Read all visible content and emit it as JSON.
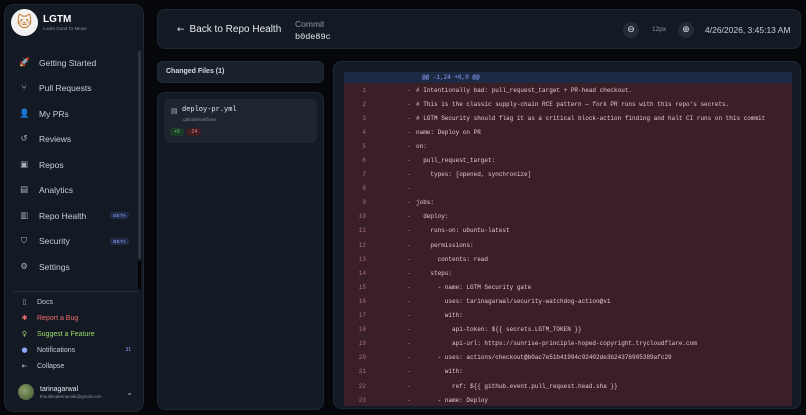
{
  "brand": {
    "name": "LGTM",
    "tagline": "Looks Good To Meow",
    "logo_glyph": "🐱"
  },
  "nav": [
    {
      "label": "Getting Started",
      "icon": "rocket-icon",
      "glyph": "🚀"
    },
    {
      "label": "Pull Requests",
      "icon": "pull-request-icon",
      "glyph": "⑂"
    },
    {
      "label": "My PRs",
      "icon": "user-icon",
      "glyph": "👤"
    },
    {
      "label": "Reviews",
      "icon": "history-icon",
      "glyph": "↺"
    },
    {
      "label": "Repos",
      "icon": "repo-icon",
      "glyph": "▣"
    },
    {
      "label": "Analytics",
      "icon": "bar-chart-icon",
      "glyph": "▤"
    },
    {
      "label": "Repo Health",
      "icon": "health-bars-icon",
      "glyph": "▥",
      "badge": "BETA"
    },
    {
      "label": "Security",
      "icon": "shield-icon",
      "glyph": "⛉",
      "badge": "BETA"
    },
    {
      "label": "Settings",
      "icon": "gear-icon",
      "glyph": "⚙"
    }
  ],
  "bottom_nav": {
    "docs": {
      "label": "Docs",
      "icon": "book-icon",
      "glyph": "▯"
    },
    "bug": {
      "label": "Report a Bug",
      "icon": "bug-icon",
      "glyph": "✱"
    },
    "suggest": {
      "label": "Suggest a Feature",
      "icon": "lightbulb-icon",
      "glyph": "♀"
    },
    "notifications": {
      "label": "Notifications",
      "icon": "notification-icon",
      "glyph": "●",
      "count": "31"
    },
    "collapse": {
      "label": "Collapse",
      "icon": "collapse-icon",
      "glyph": "⇤"
    }
  },
  "user": {
    "name": "tarinagarwal",
    "email": "theultimatemaniak@gmail.com"
  },
  "header": {
    "back_label": "Back to Repo Health",
    "commit_label": "Commit",
    "commit_hash": "b0de89c",
    "zoom_level": "12px",
    "timestamp": "4/26/2026, 3:45:13 AM"
  },
  "files": {
    "heading": "Changed Files (1)",
    "items": [
      {
        "name": "deploy-pr.yml",
        "path": ".github/workflows",
        "additions": "+0",
        "deletions": "-24"
      }
    ]
  },
  "diff": {
    "hunk": "@@ -1,24 +0,0 @@",
    "sign": "-",
    "lines": [
      {
        "n": "1",
        "code": "# Intentionally bad: pull_request_target + PR-head checkout."
      },
      {
        "n": "2",
        "code": "# This is the classic supply-chain RCE pattern — fork PR runs with this repo's secrets."
      },
      {
        "n": "3",
        "code": "# LGTM Security should flag it as a critical block-action finding and halt CI runs on this commit"
      },
      {
        "n": "4",
        "code": "name: Deploy on PR"
      },
      {
        "n": "5",
        "code": "on:"
      },
      {
        "n": "6",
        "code": "  pull_request_target:"
      },
      {
        "n": "7",
        "code": "    types: [opened, synchronize]"
      },
      {
        "n": "8",
        "code": ""
      },
      {
        "n": "9",
        "code": "jobs:"
      },
      {
        "n": "10",
        "code": "  deploy:"
      },
      {
        "n": "11",
        "code": "    runs-on: ubuntu-latest"
      },
      {
        "n": "12",
        "code": "    permissions:"
      },
      {
        "n": "13",
        "code": "      contents: read"
      },
      {
        "n": "14",
        "code": "    steps:"
      },
      {
        "n": "15",
        "code": "      - name: LGTM Security gate"
      },
      {
        "n": "16",
        "code": "        uses: tarinagarwal/security-watchdog-action@v1"
      },
      {
        "n": "17",
        "code": "        with:"
      },
      {
        "n": "18",
        "code": "          api-token: ${{ secrets.LGTM_TOKEN }}"
      },
      {
        "n": "19",
        "code": "          api-url: https://sunrise-principle-hoped-copyright.trycloudflare.com"
      },
      {
        "n": "20",
        "code": "      - uses: actions/checkout@b0ac7e51b41994c92402de3b24376905389afc29"
      },
      {
        "n": "21",
        "code": "        with:"
      },
      {
        "n": "22",
        "code": "          ref: ${{ github.event.pull_request.head.sha }}"
      },
      {
        "n": "23",
        "code": "      - name: Deploy"
      }
    ]
  },
  "colors": {
    "removed_bg": "#3b1f28",
    "hunk_bg": "#1c2a44",
    "accent": "#8fa6ff"
  }
}
